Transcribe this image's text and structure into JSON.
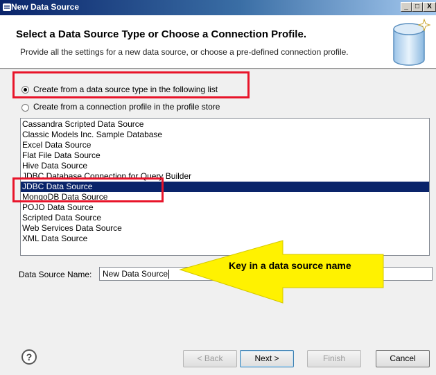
{
  "window": {
    "title": "New Data Source",
    "controls": {
      "minimize": "_",
      "maximize": "□",
      "close": "X"
    }
  },
  "header": {
    "title": "Select a Data Source Type or Choose a Connection Profile.",
    "description": "Provide all the settings for a new data source, or choose a pre-defined connection profile.",
    "icon": "database-icon"
  },
  "options": {
    "create_from_type": {
      "label": "Create from a data source type in the following list",
      "selected": true
    },
    "create_from_profile": {
      "label": "Create from a connection profile in the profile store",
      "selected": false
    }
  },
  "data_source_types": {
    "items": [
      "Cassandra Scripted Data Source",
      "Classic Models Inc. Sample Database",
      "Excel Data Source",
      "Flat File Data Source",
      "Hive Data Source",
      "JDBC Database Connection for Query Builder",
      "JDBC Data Source",
      "MongoDB Data Source",
      "POJO Data Source",
      "Scripted Data Source",
      "Web Services Data Source",
      "XML Data Source"
    ],
    "selected": "JDBC Data Source"
  },
  "name_field": {
    "label": "Data Source Name:",
    "value": "New Data Source"
  },
  "callout": {
    "text": "Key in a data source name",
    "color": "#fff200"
  },
  "buttons": {
    "help": "?",
    "back": "< Back",
    "next": "Next >",
    "finish": "Finish",
    "cancel": "Cancel"
  },
  "colors": {
    "selection": "#0a246a",
    "annotation": "#e8142a",
    "title_bar": "#0a246a"
  }
}
